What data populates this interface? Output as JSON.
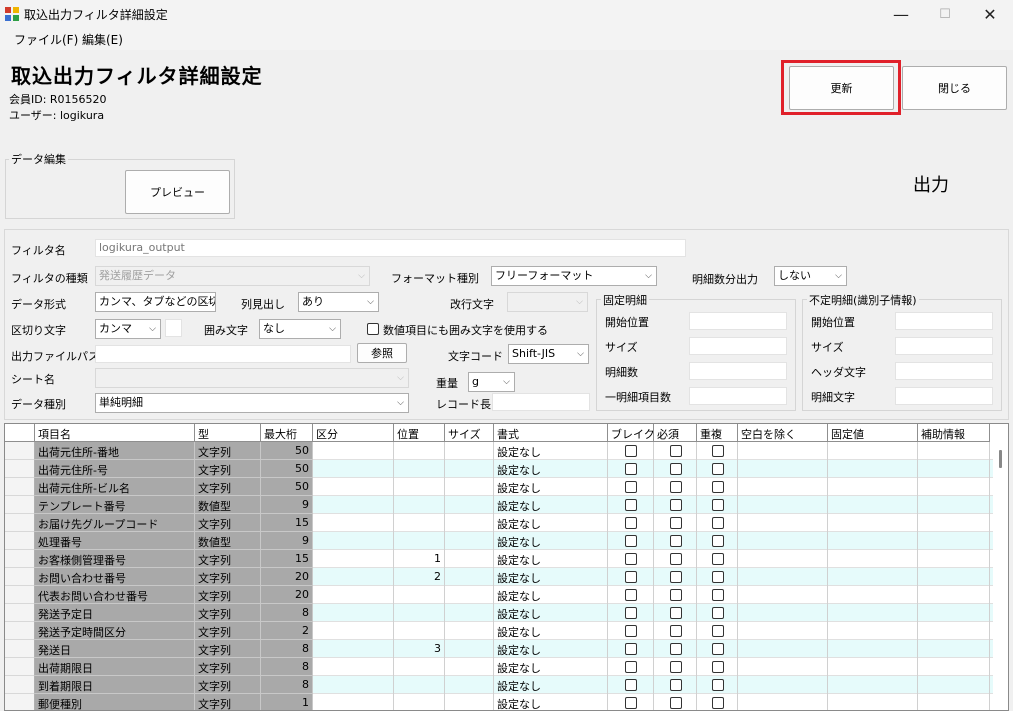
{
  "window": {
    "title": "取込出力フィルタ詳細設定",
    "controls": {
      "minimize": "—",
      "maximize": "☐",
      "close": "✕"
    }
  },
  "menu": {
    "file": "ファイル(F)",
    "edit": "編集(E)"
  },
  "header": {
    "title": "取込出力フィルタ詳細設定",
    "member_id": "会員ID: R0156520",
    "user": "ユーザー: logikura"
  },
  "buttons": {
    "update": "更新",
    "close": "閉じる",
    "preview": "プレビュー",
    "browse": "参照"
  },
  "data_edit": {
    "group_label": "データ編集"
  },
  "mode_label": "出力",
  "form": {
    "filter_name_label": "フィルタ名",
    "filter_name_value": "logikura_output",
    "filter_type_label": "フィルタの種類",
    "filter_type_value": "発送履歴データ",
    "format_type_label": "フォーマット種別",
    "format_type_value": "フリーフォーマット",
    "detail_count_label": "明細数分出力",
    "detail_count_value": "しない",
    "data_format_label": "データ形式",
    "data_format_value": "カンマ、タブなどの区切り",
    "column_header_label": "列見出し",
    "column_header_value": "あり",
    "newline_label": "改行文字",
    "newline_value": "",
    "delimiter_label": "区切り文字",
    "delimiter_value": "カンマ",
    "enclosure_label": "囲み文字",
    "enclosure_value": "なし",
    "numeric_enclose_label": "数値項目にも囲み文字を使用する",
    "output_path_label": "出力ファイルパス",
    "output_path_value": "",
    "charset_label": "文字コード",
    "charset_value": "Shift-JIS",
    "sheet_name_label": "シート名",
    "sheet_name_value": "",
    "weight_label": "重量",
    "weight_value": "g",
    "data_type_label": "データ種別",
    "data_type_value": "単純明細",
    "record_length_label": "レコード長",
    "record_length_value": ""
  },
  "fixed_detail": {
    "label": "固定明細",
    "start_position": "開始位置",
    "size": "サイズ",
    "detail_count": "明細数",
    "items_per_detail": "一明細項目数"
  },
  "variable_detail": {
    "label": "不定明細(識別子情報)",
    "start_position": "開始位置",
    "size": "サイズ",
    "header_char": "ヘッダ文字",
    "detail_char": "明細文字"
  },
  "grid": {
    "columns": [
      "項目名",
      "型",
      "最大桁",
      "区分",
      "位置",
      "サイズ",
      "書式",
      "ブレイク",
      "必須",
      "重複",
      "空白を除く",
      "固定値",
      "補助情報"
    ],
    "rows": [
      {
        "name": "出荷元住所-番地",
        "type": "文字列",
        "max": "50",
        "position": "",
        "format": "設定なし"
      },
      {
        "name": "出荷元住所-号",
        "type": "文字列",
        "max": "50",
        "position": "",
        "format": "設定なし"
      },
      {
        "name": "出荷元住所-ビル名",
        "type": "文字列",
        "max": "50",
        "position": "",
        "format": "設定なし"
      },
      {
        "name": "テンプレート番号",
        "type": "数値型",
        "max": "9",
        "position": "",
        "format": "設定なし"
      },
      {
        "name": "お届け先グループコード",
        "type": "文字列",
        "max": "15",
        "position": "",
        "format": "設定なし"
      },
      {
        "name": "処理番号",
        "type": "数値型",
        "max": "9",
        "position": "",
        "format": "設定なし"
      },
      {
        "name": "お客様側管理番号",
        "type": "文字列",
        "max": "15",
        "position": "1",
        "format": "設定なし"
      },
      {
        "name": "お問い合わせ番号",
        "type": "文字列",
        "max": "20",
        "position": "2",
        "format": "設定なし"
      },
      {
        "name": "代表お問い合わせ番号",
        "type": "文字列",
        "max": "20",
        "position": "",
        "format": "設定なし"
      },
      {
        "name": "発送予定日",
        "type": "文字列",
        "max": "8",
        "position": "",
        "format": "設定なし"
      },
      {
        "name": "発送予定時間区分",
        "type": "文字列",
        "max": "2",
        "position": "",
        "format": "設定なし"
      },
      {
        "name": "発送日",
        "type": "文字列",
        "max": "8",
        "position": "3",
        "format": "設定なし"
      },
      {
        "name": "出荷期限日",
        "type": "文字列",
        "max": "8",
        "position": "",
        "format": "設定なし"
      },
      {
        "name": "到着期限日",
        "type": "文字列",
        "max": "8",
        "position": "",
        "format": "設定なし"
      },
      {
        "name": "郵便種別",
        "type": "文字列",
        "max": "1",
        "position": "",
        "format": "設定なし"
      }
    ]
  },
  "colors": {
    "highlight": "#e0202a",
    "row_alt": "#e6fbfb",
    "name_cell": "#a9a9a9"
  }
}
